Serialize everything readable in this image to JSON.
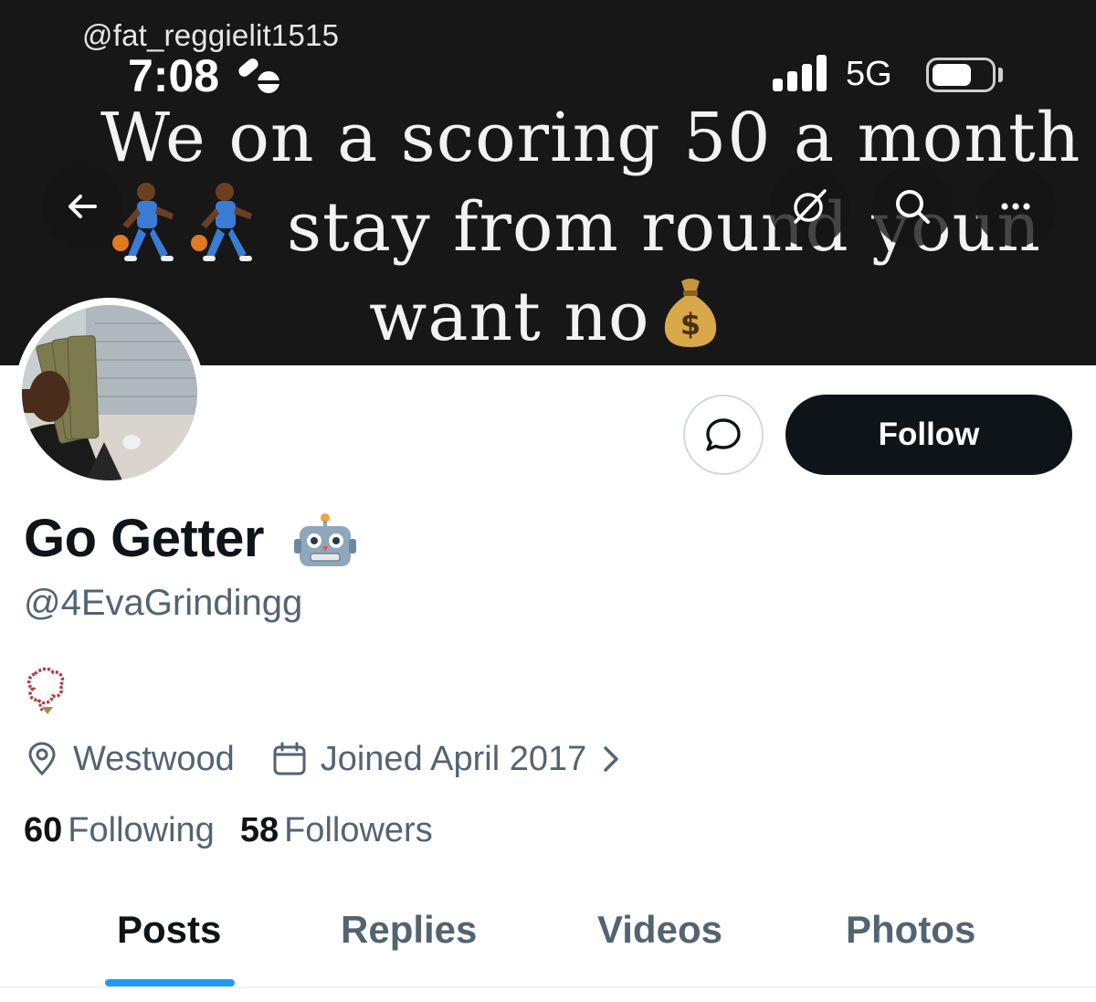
{
  "status_bar": {
    "watermark": "@fat_reggielit1515",
    "time": "7:08",
    "network": "5G"
  },
  "banner": {
    "line1": "We on a scoring 50 a month",
    "line2": "stay from round youn",
    "line3": "want no",
    "emojis": [
      "basketball-player-emoji",
      "basketball-player-emoji",
      "money-bag-emoji"
    ]
  },
  "nav_icons": [
    "back-arrow-icon",
    "grok-icon",
    "search-icon",
    "more-icon"
  ],
  "profile": {
    "display_name": "Go Getter",
    "name_emoji": "robot-emoji",
    "handle": "@4EvaGrindingg",
    "bio_emoji": "prayer-beads-emoji",
    "location": "Westwood",
    "joined": "Joined April 2017",
    "following_count": "60",
    "following_label": "Following",
    "followers_count": "58",
    "followers_label": "Followers"
  },
  "actions": {
    "follow_label": "Follow",
    "message_icon": "message-bubble-icon"
  },
  "tabs": [
    {
      "label": "Posts",
      "active": true
    },
    {
      "label": "Replies",
      "active": false
    },
    {
      "label": "Videos",
      "active": false
    },
    {
      "label": "Photos",
      "active": false
    }
  ],
  "colors": {
    "accent": "#1d9bf0",
    "text_primary": "#0f1419",
    "text_secondary": "#536471",
    "button_dark": "#0f1419",
    "banner_bg": "#171717"
  }
}
